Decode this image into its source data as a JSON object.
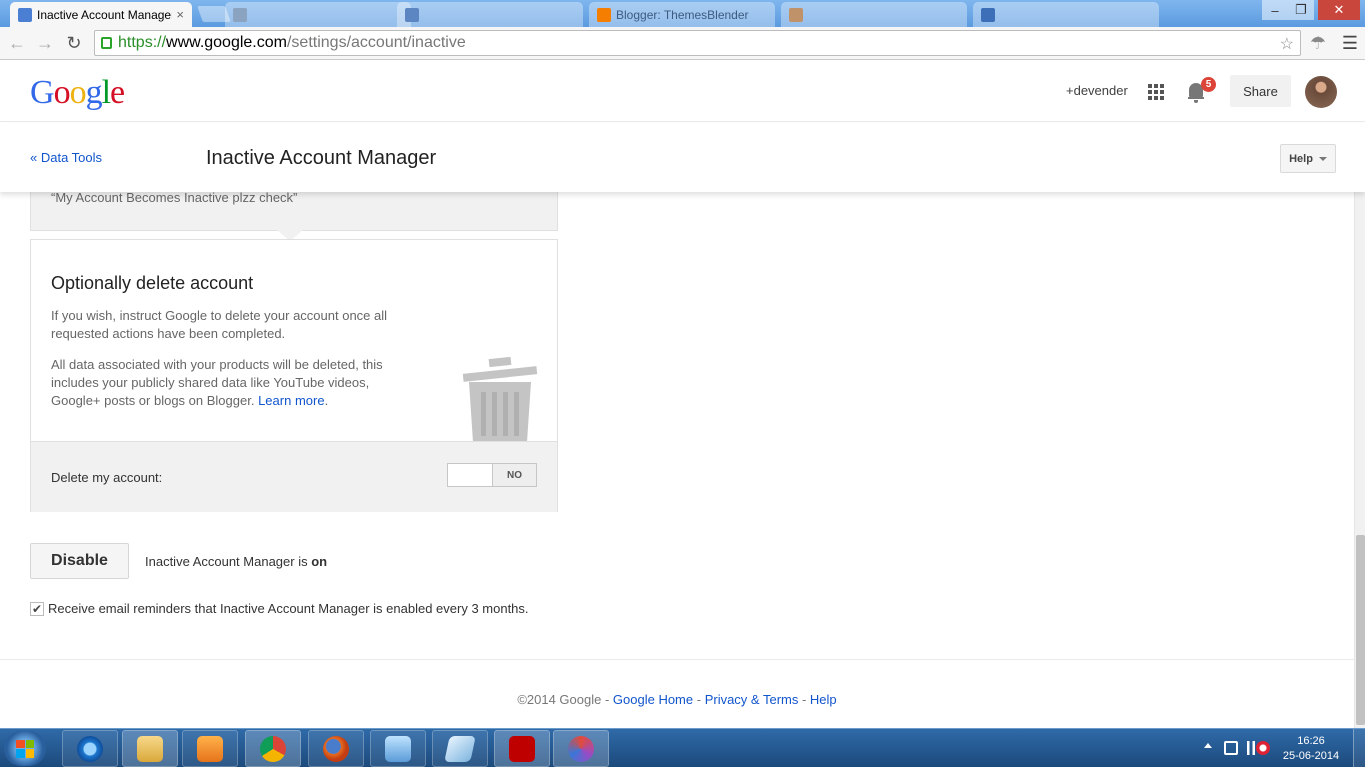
{
  "browser": {
    "active_tab": {
      "title": "Inactive Account Manager",
      "close": "×"
    },
    "inactive_tabs": [
      {
        "title": ""
      },
      {
        "title": ""
      },
      {
        "title": "Blogger: ThemesBlender"
      },
      {
        "title": ""
      },
      {
        "title": ""
      }
    ],
    "url": {
      "scheme": "https://",
      "host": "www.google.com",
      "path": "/settings/account/inactive"
    },
    "window_controls": {
      "minimize": "–",
      "maximize": "❐",
      "close": "✕"
    }
  },
  "header": {
    "logo": "Google",
    "user": "+devender",
    "notification_count": "5",
    "share_label": "Share"
  },
  "subheader": {
    "breadcrumb": "« Data Tools",
    "title": "Inactive Account Manager",
    "help_label": "Help"
  },
  "previous_section": {
    "quote": "“My Account Becomes Inactive plzz check”"
  },
  "delete_section": {
    "heading": "Optionally delete account",
    "para1": "If you wish, instruct Google to delete your account once all requested actions have been completed.",
    "para2": "All data associated with your products will be deleted, this includes your publicly shared data like YouTube videos, Google+ posts or blogs on Blogger.",
    "learn_more": "Learn more",
    "period": ".",
    "toggle_label": "Delete my account:",
    "toggle_state": "NO"
  },
  "actions": {
    "disable_label": "Disable",
    "status_prefix": "Inactive Account Manager is ",
    "status_value": "on",
    "reminder_checked": true,
    "reminder_text": "Receive email reminders that Inactive Account Manager is enabled every 3 months."
  },
  "footer": {
    "copyright": "©2014 Google",
    "sep": " - ",
    "links": [
      "Google Home",
      "Privacy & Terms",
      "Help"
    ]
  },
  "taskbar": {
    "time": "16:26",
    "date": "25-06-2014"
  },
  "colors": {
    "link": "#1155cc",
    "badge": "#db4437",
    "https_green": "#2a8f2a"
  }
}
